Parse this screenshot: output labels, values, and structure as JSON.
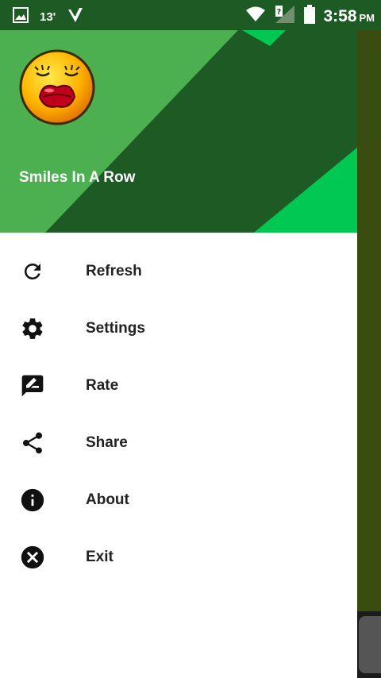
{
  "status_bar": {
    "temperature": "13'",
    "time": "3:58",
    "ampm": "PM",
    "icons": [
      "gallery-icon",
      "check-icon",
      "wifi-icon",
      "signal-icon",
      "battery-icon"
    ]
  },
  "drawer": {
    "app_name": "Smiles In A Row",
    "avatar": "kiss-smiley-icon",
    "colors": {
      "dark": "#1e5a24",
      "mid": "#4caf50",
      "accent": "#00c853"
    },
    "items": [
      {
        "label": "Refresh",
        "icon": "refresh-icon"
      },
      {
        "label": "Settings",
        "icon": "gear-icon"
      },
      {
        "label": "Rate",
        "icon": "rate-icon"
      },
      {
        "label": "Share",
        "icon": "share-icon"
      },
      {
        "label": "About",
        "icon": "info-icon"
      },
      {
        "label": "Exit",
        "icon": "close-circle-icon"
      }
    ]
  }
}
